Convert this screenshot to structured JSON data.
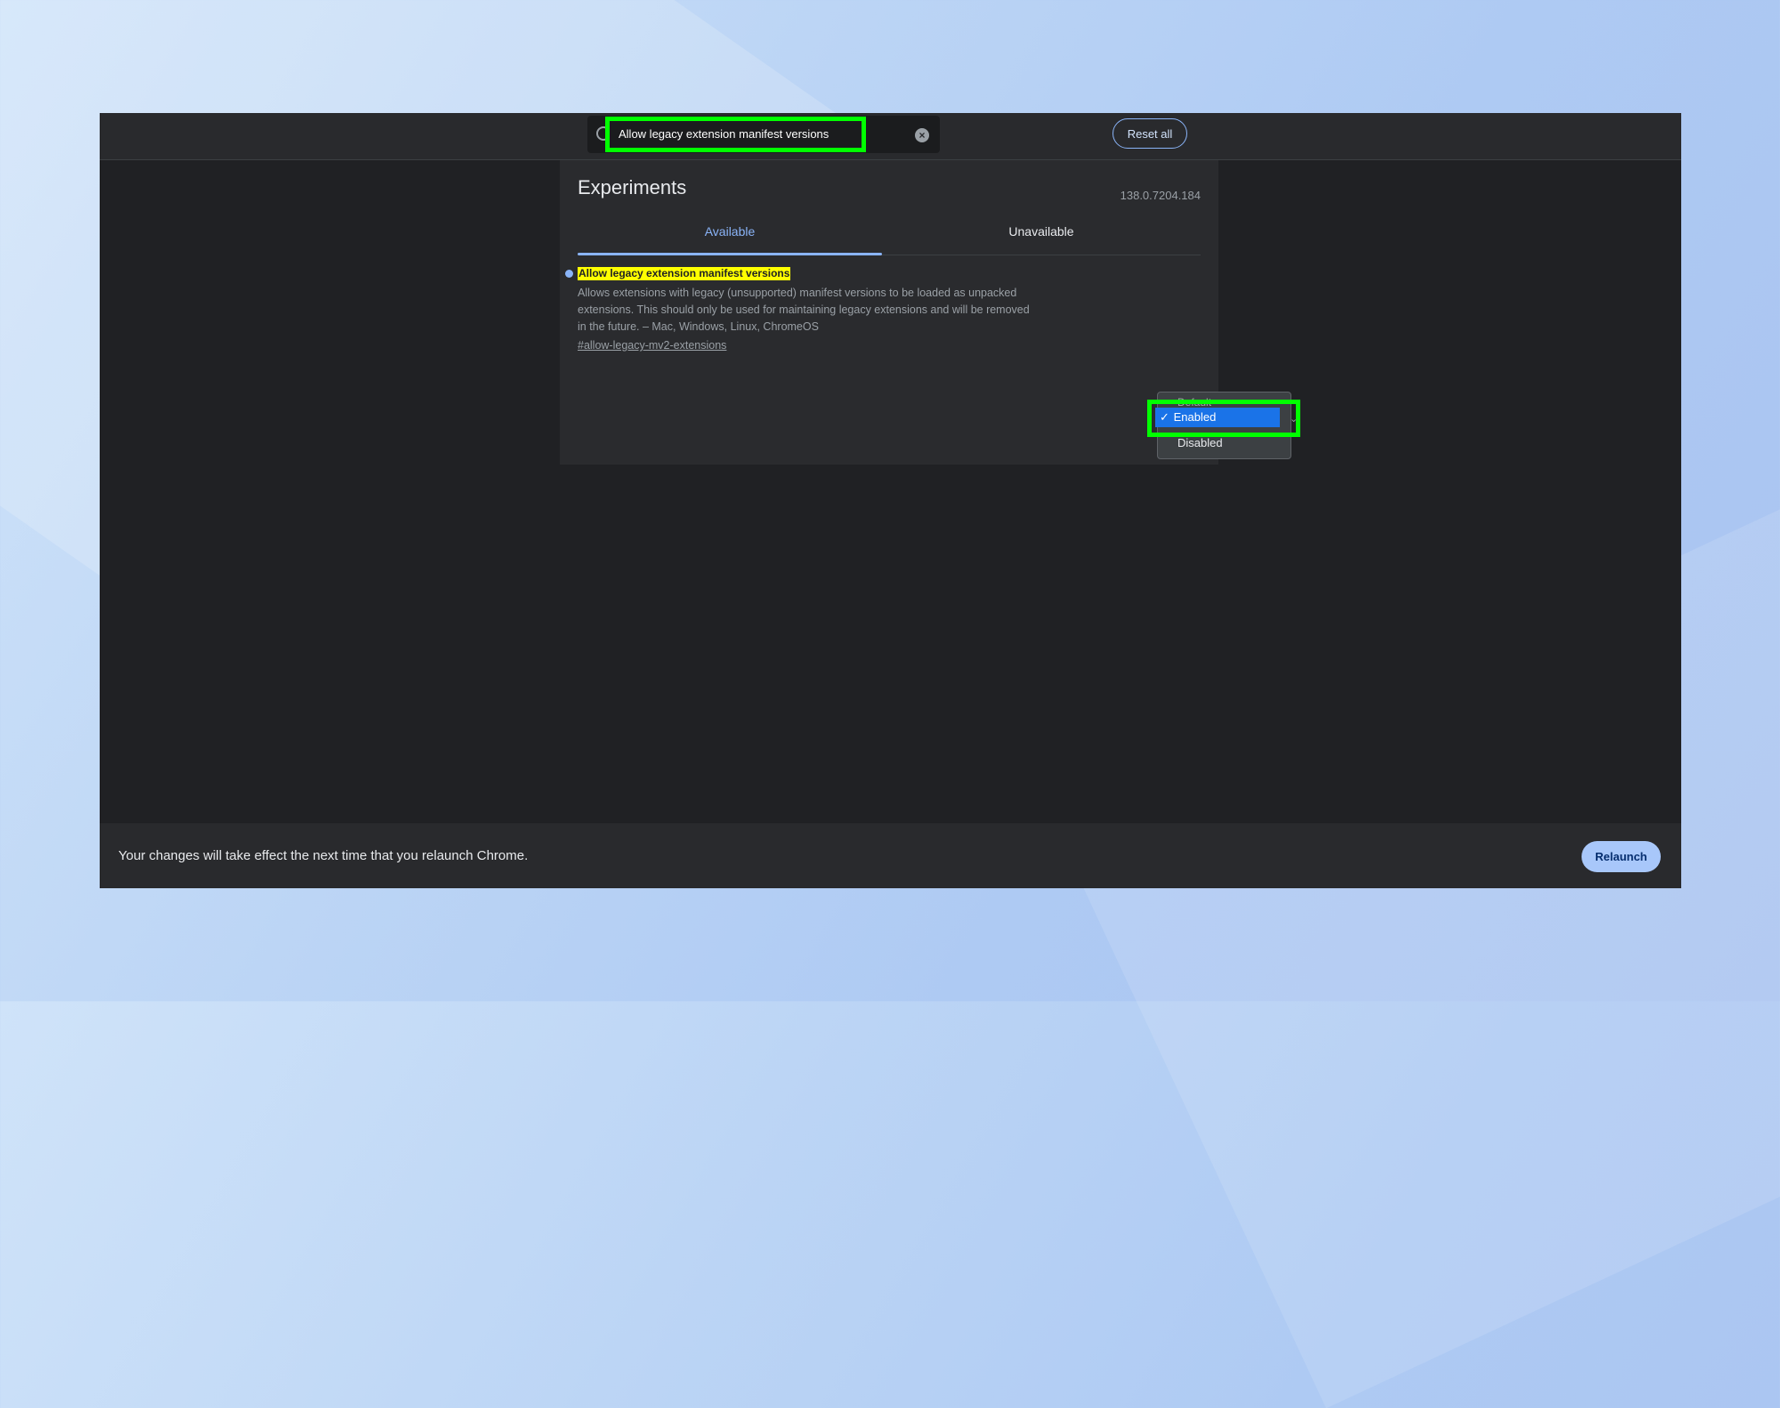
{
  "search": {
    "value": "Allow legacy extension manifest versions",
    "clear_glyph": "×"
  },
  "toolbar": {
    "reset_all_label": "Reset all"
  },
  "header": {
    "title": "Experiments",
    "version": "138.0.7204.184"
  },
  "tabs": [
    {
      "label": "Available",
      "active": true
    },
    {
      "label": "Unavailable",
      "active": false
    }
  ],
  "experiment": {
    "title": "Allow legacy extension manifest versions",
    "description": "Allows extensions with legacy (unsupported) manifest versions to be loaded as unpacked extensions. This should only be used for maintaining legacy extensions and will be removed in the future. – Mac, Windows, Linux, ChromeOS",
    "link": "#allow-legacy-mv2-extensions"
  },
  "dropdown": {
    "options": [
      "Default",
      "Enabled",
      "Disabled"
    ],
    "selected": "Enabled",
    "check_glyph": "✓"
  },
  "footer": {
    "message": "Your changes will take effect the next time that you relaunch Chrome.",
    "relaunch_label": "Relaunch"
  },
  "colors": {
    "accent": "#8ab4f8",
    "highlight_box": "#00ff00",
    "search_match": "#ffff00",
    "selected_option": "#1a73e8"
  }
}
